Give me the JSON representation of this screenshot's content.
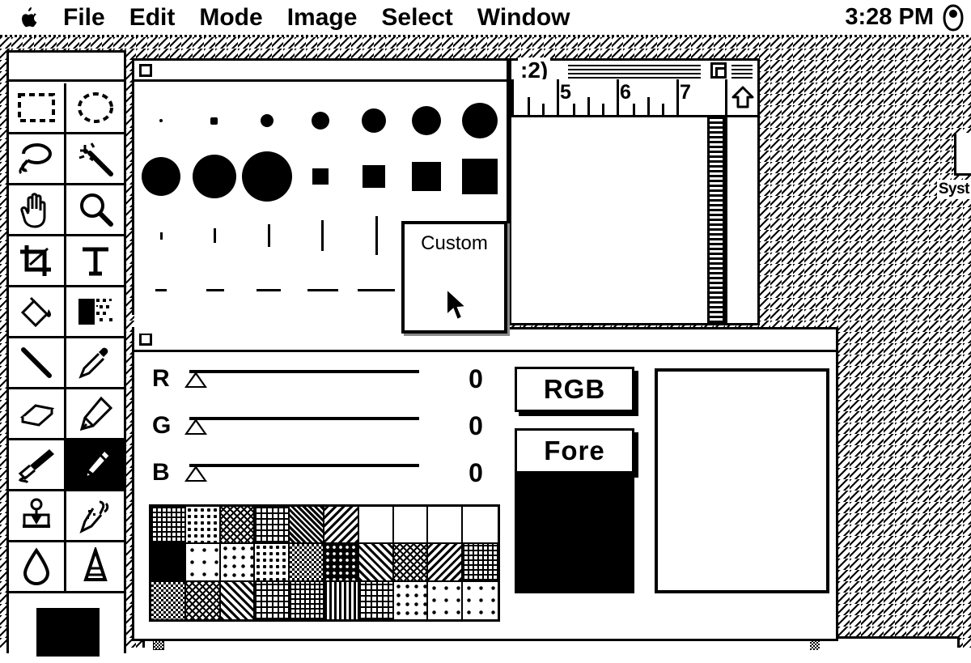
{
  "menubar": {
    "apple_icon": "apple-logo-icon",
    "items": [
      {
        "label": "File"
      },
      {
        "label": "Edit"
      },
      {
        "label": "Mode"
      },
      {
        "label": "Image"
      },
      {
        "label": "Select"
      },
      {
        "label": "Window"
      }
    ],
    "clock": "3:28 PM",
    "app_menu_icon": "application-menu-icon"
  },
  "desktop": {
    "pattern": "diagonal-hatch",
    "icon_label": "Syst"
  },
  "toolbox": {
    "title": "",
    "tools": [
      {
        "name": "rectangular-marquee-tool",
        "selected": false
      },
      {
        "name": "elliptical-marquee-tool",
        "selected": false
      },
      {
        "name": "lasso-tool",
        "selected": false
      },
      {
        "name": "magic-wand-tool",
        "selected": false
      },
      {
        "name": "hand-tool",
        "selected": false
      },
      {
        "name": "zoom-tool",
        "selected": false
      },
      {
        "name": "crop-tool",
        "selected": false
      },
      {
        "name": "type-tool",
        "selected": false
      },
      {
        "name": "paint-bucket-tool",
        "selected": false
      },
      {
        "name": "gradient-tool",
        "selected": false
      },
      {
        "name": "line-tool",
        "selected": false
      },
      {
        "name": "eyedropper-tool",
        "selected": false
      },
      {
        "name": "eraser-tool",
        "selected": false
      },
      {
        "name": "pencil-tool",
        "selected": false
      },
      {
        "name": "airbrush-tool",
        "selected": false
      },
      {
        "name": "paintbrush-tool",
        "selected": true
      },
      {
        "name": "rubber-stamp-tool",
        "selected": false
      },
      {
        "name": "smudge-tool",
        "selected": false
      },
      {
        "name": "blur-tool",
        "selected": false
      },
      {
        "name": "sharpen-tool",
        "selected": false
      }
    ],
    "foreground_color": "#000000"
  },
  "brushes": {
    "title": "",
    "rows": [
      {
        "kind": "dot",
        "sizes": [
          4,
          8,
          14,
          20,
          27,
          33,
          41
        ]
      },
      {
        "kind": "mixed",
        "sizes": [
          45,
          50,
          57,
          19,
          26,
          33,
          41
        ]
      },
      {
        "kind": "vline",
        "sizes": [
          9,
          17,
          27,
          37,
          47
        ]
      },
      {
        "kind": "hline",
        "sizes": [
          14,
          22,
          30,
          38,
          46
        ]
      }
    ],
    "custom_panel": {
      "label": "Custom",
      "cursor": "arrow-cursor"
    }
  },
  "document": {
    "title": ":2)",
    "ruler_units": "inches",
    "ruler_numbers": [
      "5",
      "6",
      "7"
    ],
    "scroll_up_icon": "up-arrow-icon"
  },
  "colors": {
    "title": "",
    "sliders": [
      {
        "label": "R",
        "value": "0",
        "percent": 0
      },
      {
        "label": "G",
        "value": "0",
        "percent": 0
      },
      {
        "label": "B",
        "value": "0",
        "percent": 0
      }
    ],
    "buttons": [
      {
        "label": "RGB",
        "name": "color-model-button"
      },
      {
        "label": "Fore",
        "name": "foreground-background-button"
      }
    ],
    "current_color": "#000000",
    "color_field_color": "#ffffff",
    "patterns": [
      "p-grid",
      "p-25",
      "p-weave",
      "p-cross",
      "p-dense",
      "p-diag2",
      "p-white",
      "p-white",
      "p-white",
      "p-white",
      "p-black",
      "p-6",
      "p-12",
      "p-25",
      "p-50",
      "p-75",
      "p-diag1",
      "p-weave",
      "p-diag2",
      "p-grid",
      "p-50",
      "p-weave",
      "p-diag1",
      "p-cross",
      "p-grid",
      "p-vlines",
      "p-cross",
      "p-12",
      "p-6",
      "p-6"
    ]
  }
}
